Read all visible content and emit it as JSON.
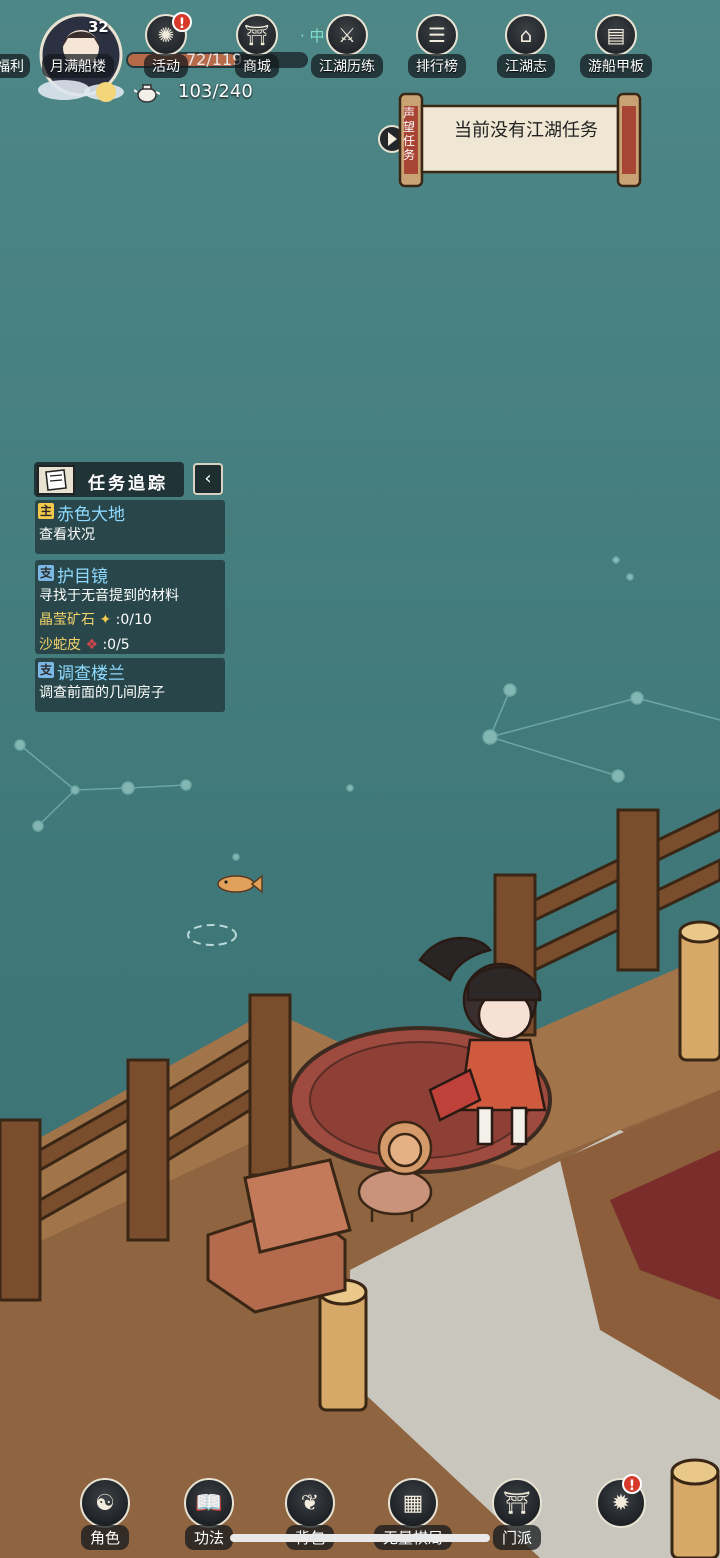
{
  "top_menu": {
    "partial_left_label": "福利",
    "items": [
      {
        "label": "月满船楼",
        "icon": "ship-tower-icon"
      },
      {
        "label": "活动",
        "icon": "event-icon",
        "badge": "!"
      },
      {
        "label": "商城",
        "icon": "shop-icon"
      },
      {
        "label": "江湖历练",
        "icon": "training-icon"
      },
      {
        "label": "排行榜",
        "icon": "ranking-icon"
      },
      {
        "label": "江湖志",
        "icon": "chronicle-icon"
      },
      {
        "label": "游船甲板",
        "icon": "deck-icon"
      }
    ]
  },
  "player": {
    "level": "32",
    "hp_text": "72/119",
    "hp_ratio": 0.605,
    "stamina": "103/240",
    "location_fragment": "· 中"
  },
  "reputation_task": {
    "tab_label": "声望任务",
    "text": "当前没有江湖任务"
  },
  "quest_tracker": {
    "title": "任务追踪",
    "toggle_symbol": "‹",
    "quests": [
      {
        "tag": "主",
        "name": "赤色大地",
        "desc": "查看状况"
      },
      {
        "tag": "支",
        "name": "护目镜",
        "desc": "寻找于无音提到的材料",
        "materials": [
          {
            "name": "晶莹矿石",
            "count": ":0/10"
          },
          {
            "name": "沙蛇皮",
            "count": ":0/5"
          }
        ]
      },
      {
        "tag": "支",
        "name": "调查楼兰",
        "desc": "调查前面的几间房子"
      }
    ]
  },
  "bottom_nav": {
    "items": [
      {
        "label": "角色",
        "icon": "character-icon"
      },
      {
        "label": "功法",
        "icon": "skills-book-icon"
      },
      {
        "label": "背包",
        "icon": "backpack-icon"
      },
      {
        "label": "无量棋局",
        "icon": "chess-board-icon"
      },
      {
        "label": "门派",
        "icon": "sect-gate-icon"
      },
      {
        "label": "",
        "icon": "sect-emblem-icon",
        "badge": "!"
      }
    ]
  },
  "colors": {
    "sea": "#4d8484",
    "deck_wood": "#a1744a",
    "quest_name": "#8fd9ff",
    "material": "#f2d36a",
    "badge": "#d73a2b"
  }
}
